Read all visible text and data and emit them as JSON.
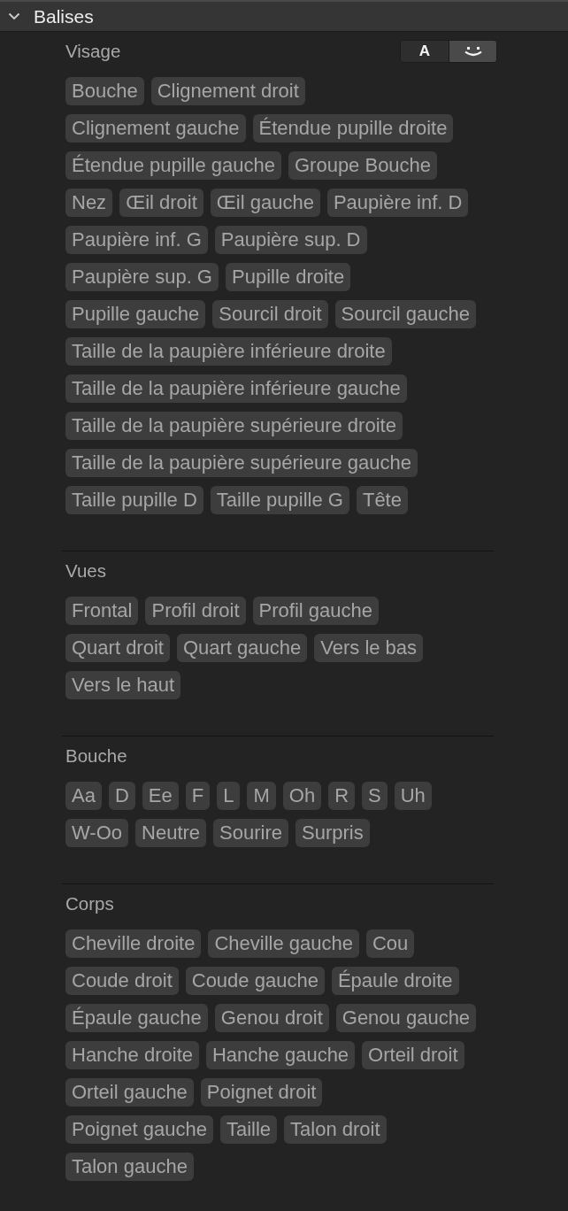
{
  "panel": {
    "title": "Balises",
    "expanded": true
  },
  "sections": [
    {
      "title": "Visage",
      "view_toggle": {
        "options": [
          {
            "kind": "text",
            "label": "A",
            "selected": false
          },
          {
            "kind": "face",
            "selected": true
          }
        ]
      },
      "tag_rows": [
        [
          "Bouche",
          "Clignement droit"
        ],
        [
          "Clignement gauche",
          "Étendue pupille droite"
        ],
        [
          "Étendue pupille gauche",
          "Groupe Bouche"
        ],
        [
          "Nez",
          "Œil droit",
          "Œil gauche",
          "Paupière inf. D"
        ],
        [
          "Paupière inf. G",
          "Paupière sup. D"
        ],
        [
          "Paupière sup. G",
          "Pupille droite"
        ],
        [
          "Pupille gauche",
          "Sourcil droit",
          "Sourcil gauche"
        ],
        [
          "Taille de la paupière inférieure droite"
        ],
        [
          "Taille de la paupière inférieure gauche"
        ],
        [
          "Taille de la paupière supérieure droite"
        ],
        [
          "Taille de la paupière supérieure gauche"
        ],
        [
          "Taille pupille D",
          "Taille pupille G",
          "Tête"
        ]
      ]
    },
    {
      "title": "Vues",
      "tag_rows": [
        [
          "Frontal",
          "Profil droit",
          "Profil gauche"
        ],
        [
          "Quart droit",
          "Quart gauche",
          "Vers le bas"
        ],
        [
          "Vers le haut"
        ]
      ]
    },
    {
      "title": "Bouche",
      "tag_rows": [
        [
          "Aa",
          "D",
          "Ee",
          "F",
          "L",
          "M",
          "Oh",
          "R",
          "S",
          "Uh"
        ],
        [
          "W-Oo",
          "Neutre",
          "Sourire",
          "Surpris"
        ]
      ]
    },
    {
      "title": "Corps",
      "tag_rows": [
        [
          "Cheville droite",
          "Cheville gauche",
          "Cou"
        ],
        [
          "Coude droit",
          "Coude gauche",
          "Épaule droite"
        ],
        [
          "Épaule gauche",
          "Genou droit",
          "Genou gauche"
        ],
        [
          "Hanche droite",
          "Hanche gauche",
          "Orteil droit"
        ],
        [
          "Orteil gauche",
          "Poignet droit"
        ],
        [
          "Poignet gauche",
          "Taille",
          "Talon droit"
        ],
        [
          "Talon gauche"
        ]
      ]
    }
  ]
}
